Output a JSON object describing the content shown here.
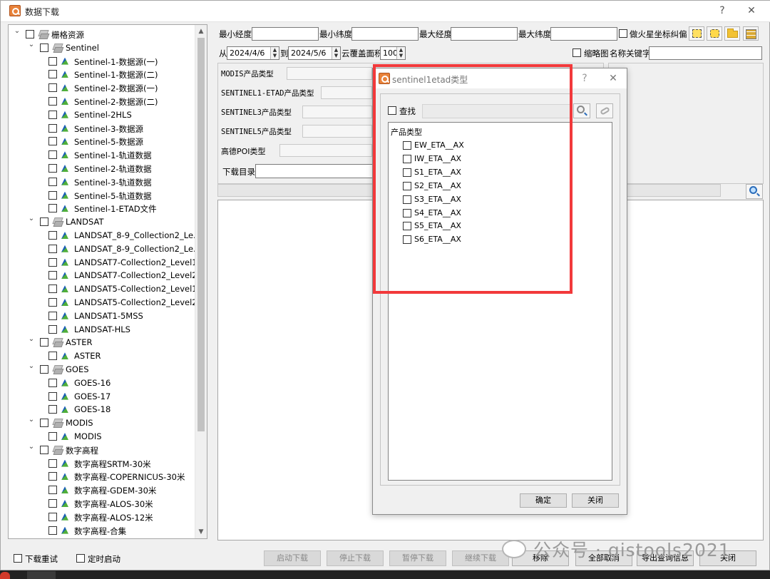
{
  "window": {
    "title": "数据下载",
    "help": "?",
    "close": "✕"
  },
  "tree": {
    "items": [
      {
        "level": 0,
        "expander": "v",
        "icon": "layer",
        "label": "栅格资源"
      },
      {
        "level": 1,
        "expander": "v",
        "icon": "layer",
        "label": "Sentinel"
      },
      {
        "level": 2,
        "expander": "",
        "icon": "raster",
        "label": "Sentinel-1-数据源(一)"
      },
      {
        "level": 2,
        "expander": "",
        "icon": "raster",
        "label": "Sentinel-1-数据源(二)"
      },
      {
        "level": 2,
        "expander": "",
        "icon": "raster",
        "label": "Sentinel-2-数据源(一)"
      },
      {
        "level": 2,
        "expander": "",
        "icon": "raster",
        "label": "Sentinel-2-数据源(二)"
      },
      {
        "level": 2,
        "expander": "",
        "icon": "raster",
        "label": "Sentinel-2HLS"
      },
      {
        "level": 2,
        "expander": "",
        "icon": "raster",
        "label": "Sentinel-3-数据源"
      },
      {
        "level": 2,
        "expander": "",
        "icon": "raster",
        "label": "Sentinel-5-数据源"
      },
      {
        "level": 2,
        "expander": "",
        "icon": "raster",
        "label": "Sentinel-1-轨道数据"
      },
      {
        "level": 2,
        "expander": "",
        "icon": "raster",
        "label": "Sentinel-2-轨道数据"
      },
      {
        "level": 2,
        "expander": "",
        "icon": "raster",
        "label": "Sentinel-3-轨道数据"
      },
      {
        "level": 2,
        "expander": "",
        "icon": "raster",
        "label": "Sentinel-5-轨道数据"
      },
      {
        "level": 2,
        "expander": "",
        "icon": "raster",
        "label": "Sentinel-1-ETAD文件"
      },
      {
        "level": 1,
        "expander": "v",
        "icon": "layer",
        "label": "LANDSAT"
      },
      {
        "level": 2,
        "expander": "",
        "icon": "raster",
        "label": "LANDSAT_8-9_Collection2_Le..."
      },
      {
        "level": 2,
        "expander": "",
        "icon": "raster",
        "label": "LANDSAT_8-9_Collection2_Le..."
      },
      {
        "level": 2,
        "expander": "",
        "icon": "raster",
        "label": "LANDSAT7-Collection2_Level1"
      },
      {
        "level": 2,
        "expander": "",
        "icon": "raster",
        "label": "LANDSAT7-Collection2_Level2"
      },
      {
        "level": 2,
        "expander": "",
        "icon": "raster",
        "label": "LANDSAT5-Collection2_Level1"
      },
      {
        "level": 2,
        "expander": "",
        "icon": "raster",
        "label": "LANDSAT5-Collection2_Level2"
      },
      {
        "level": 2,
        "expander": "",
        "icon": "raster",
        "label": "LANDSAT1-5MSS"
      },
      {
        "level": 2,
        "expander": "",
        "icon": "raster",
        "label": "LANDSAT-HLS"
      },
      {
        "level": 1,
        "expander": "v",
        "icon": "layer",
        "label": "ASTER"
      },
      {
        "level": 2,
        "expander": "",
        "icon": "raster",
        "label": "ASTER"
      },
      {
        "level": 1,
        "expander": "v",
        "icon": "layer",
        "label": "GOES"
      },
      {
        "level": 2,
        "expander": "",
        "icon": "raster",
        "label": "GOES-16"
      },
      {
        "level": 2,
        "expander": "",
        "icon": "raster",
        "label": "GOES-17"
      },
      {
        "level": 2,
        "expander": "",
        "icon": "raster",
        "label": "GOES-18"
      },
      {
        "level": 1,
        "expander": "v",
        "icon": "layer",
        "label": "MODIS"
      },
      {
        "level": 2,
        "expander": "",
        "icon": "raster",
        "label": "MODIS"
      },
      {
        "level": 1,
        "expander": "v",
        "icon": "layer",
        "label": "数字高程"
      },
      {
        "level": 2,
        "expander": "",
        "icon": "raster",
        "label": "数字高程SRTM-30米"
      },
      {
        "level": 2,
        "expander": "",
        "icon": "raster",
        "label": "数字高程-COPERNICUS-30米"
      },
      {
        "level": 2,
        "expander": "",
        "icon": "raster",
        "label": "数字高程-GDEM-30米"
      },
      {
        "level": 2,
        "expander": "",
        "icon": "raster",
        "label": "数字高程-ALOS-30米"
      },
      {
        "level": 2,
        "expander": "",
        "icon": "raster",
        "label": "数字高程-ALOS-12米"
      },
      {
        "level": 2,
        "expander": "",
        "icon": "raster",
        "label": "数字高程-合集"
      }
    ]
  },
  "query": {
    "min_lon_label": "最小经度",
    "min_lat_label": "最小纬度",
    "max_lon_label": "最大经度",
    "max_lat_label": "最大纬度",
    "mars_label": "火星坐标纠偏",
    "mars_prefix": "做",
    "from_label": "从",
    "from_date": "2024/4/6",
    "to_label": "到",
    "to_date": "2024/5/6",
    "cloud_label": "云覆盖面积",
    "cloud_value": "100",
    "thumb_label": "缩略图",
    "keyword_label": "名称关键字",
    "modis_label": "MODIS产品类型",
    "s1etad_label": "SENTINEL1-ETAD产品类型",
    "s3_label": "SENTINEL3产品类型",
    "s5_label": "SENTINEL5产品类型",
    "poi_label": "高德POI类型",
    "dir_label": "下载目录"
  },
  "bottom": {
    "redownload": "下载重试",
    "timed_start": "定时启动",
    "start": "启动下载",
    "stop": "停止下载",
    "pause": "暂停下载",
    "resume": "继续下载",
    "remove": "移除",
    "cancel_all": "全部取消",
    "export": "导出查询信息",
    "close": "关闭"
  },
  "watermark": "公众号 · gistools2021",
  "dialog": {
    "title": "sentinel1etad类型",
    "help": "?",
    "close": "✕",
    "search_label": "查找",
    "group_label": "产品类型",
    "items": [
      "EW_ETA__AX",
      "IW_ETA__AX",
      "S1_ETA__AX",
      "S2_ETA__AX",
      "S3_ETA__AX",
      "S4_ETA__AX",
      "S5_ETA__AX",
      "S6_ETA__AX"
    ],
    "ok": "确定",
    "close_btn": "关闭"
  },
  "colors": {
    "highlight": "#f2393b",
    "tree_icon_blue": "#1b5fb4",
    "tree_icon_green": "#4fae3a"
  }
}
